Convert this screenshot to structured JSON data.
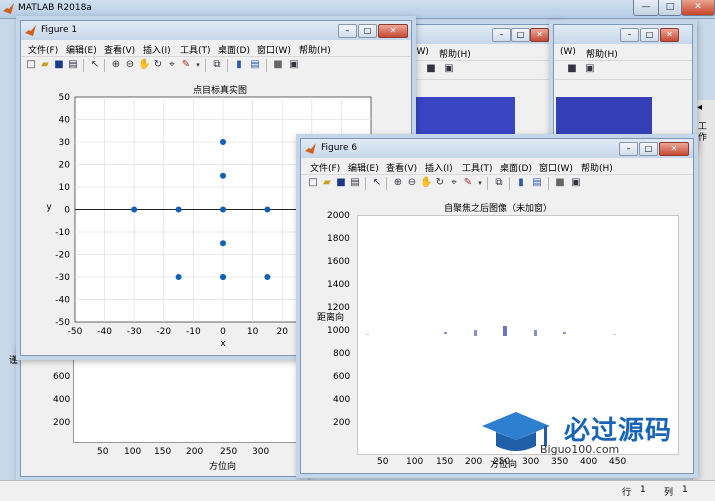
{
  "app": {
    "title": "MATLAB R2018a",
    "minimize": "—",
    "maximize": "□",
    "close": "✕"
  },
  "colors": {
    "marker": "#0f60b6",
    "titlebar": "#c9d8e8",
    "heatmap": "#3340b8"
  },
  "menu": [
    "文件(F)",
    "编辑(E)",
    "查看(V)",
    "插入(I)",
    "工具(T)",
    "桌面(D)",
    "窗口(W)",
    "帮助(H)"
  ],
  "back_windows": {
    "menu_w": "(W)",
    "menu_h": "帮助(H)"
  },
  "sidebar": {
    "label": "工作",
    "arrow": "◂"
  },
  "fig1": {
    "title": "Figure 1",
    "plot_title": "点目标真实图",
    "xlabel": "x",
    "ylabel": "y",
    "xticks": [
      "-50",
      "-40",
      "-30",
      "-20",
      "-10",
      "0",
      "10",
      "20"
    ],
    "yticks": [
      "50",
      "40",
      "30",
      "20",
      "10",
      "0",
      "-10",
      "-20",
      "-30",
      "-40",
      "-50"
    ]
  },
  "fig6": {
    "title": "Figure 6",
    "plot_title": "自聚焦之后图像（未加窗）",
    "ylabel": "距离向",
    "yticks": [
      "2000",
      "1800",
      "1600",
      "1400",
      "1200",
      "1000",
      "800",
      "600",
      "400",
      "200"
    ],
    "xticks": [
      "50",
      "100",
      "150",
      "200",
      "250",
      "300",
      "350",
      "400",
      "450"
    ],
    "xlabel": "方位向"
  },
  "fig_behind": {
    "yticks": [
      "600",
      "400",
      "200"
    ],
    "xticks": [
      "50",
      "100",
      "150",
      "200",
      "250",
      "300"
    ],
    "xlabel": "方位向",
    "cut_label": "谨"
  },
  "watermark": {
    "cn": "必过源码",
    "en": "Biguo100.com"
  },
  "statusbar": {
    "row_label": "行",
    "row": "1",
    "col_label": "列",
    "col": "1"
  },
  "chart_data": [
    {
      "type": "scatter",
      "title": "点目标真实图",
      "xlabel": "x",
      "ylabel": "y",
      "xlim": [
        -50,
        50
      ],
      "ylim": [
        -50,
        50
      ],
      "grid": true,
      "x": [
        0,
        -15,
        -30,
        15,
        0,
        0,
        0,
        0,
        -15,
        0,
        15
      ],
      "y": [
        0,
        0,
        0,
        0,
        15,
        30,
        -15,
        -30,
        -30,
        -30,
        -30
      ]
    }
  ]
}
